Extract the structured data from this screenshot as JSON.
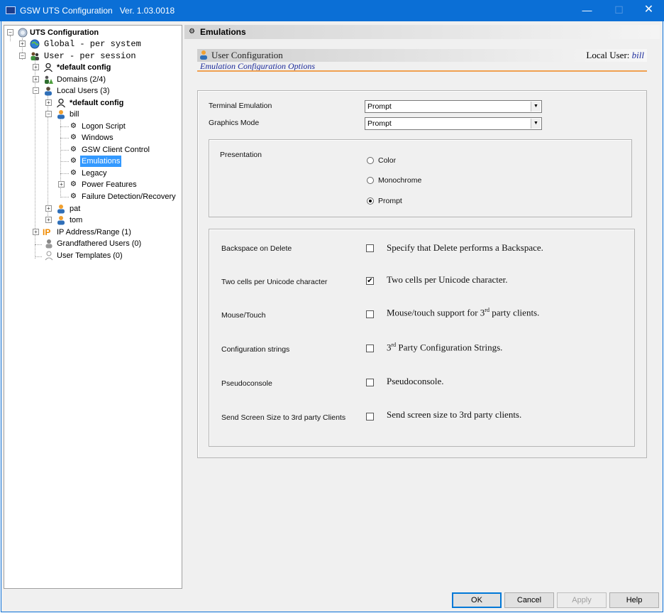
{
  "window": {
    "title": "GSW UTS Configuration",
    "version": "Ver. 1.03.0018",
    "minimize": "—",
    "maximize": "☐",
    "close": "✕"
  },
  "tree": {
    "root": "UTS Configuration",
    "global": "Global - per system",
    "user": "User  - per session",
    "default_config": "*default config",
    "domains": "Domains (2/4)",
    "local_users": "Local Users (3)",
    "lu_default_config": "*default config",
    "bill": "bill",
    "bill_children": [
      "Logon Script",
      "Windows",
      "GSW Client Control",
      "Emulations",
      "Legacy",
      "Power Features",
      "Failure Detection/Recovery"
    ],
    "pat": "pat",
    "tom": "tom",
    "ip_range": "IP Address/Range (1)",
    "grandfathered": "Grandfathered Users (0)",
    "user_templates": "User Templates (0)",
    "ip_icon_text": "IP"
  },
  "header": {
    "title": "Emulations"
  },
  "user_config": {
    "title": "User Configuration",
    "local_user_label": "Local User:",
    "local_user_name": "bill",
    "subtitle": "Emulation Configuration Options"
  },
  "form": {
    "terminal_emulation_label": "Terminal Emulation",
    "terminal_emulation_value": "Prompt",
    "graphics_mode_label": "Graphics Mode",
    "graphics_mode_value": "Prompt",
    "presentation_label": "Presentation",
    "presentation_options": [
      "Color",
      "Monochrome",
      "Prompt"
    ],
    "presentation_selected": "Prompt"
  },
  "options": [
    {
      "label": "Backspace on Delete",
      "checked": false,
      "desc": "Specify that Delete performs a Backspace."
    },
    {
      "label": "Two cells per Unicode character",
      "checked": true,
      "desc": "Two cells per Unicode character."
    },
    {
      "label": "Mouse/Touch",
      "checked": false,
      "desc_pre": "Mouse/touch support for 3",
      "desc_sup": "rd",
      "desc_post": " party clients."
    },
    {
      "label": "Configuration strings",
      "checked": false,
      "desc_pre": "3",
      "desc_sup": "rd",
      "desc_post": " Party Configuration Strings."
    },
    {
      "label": "Pseudoconsole",
      "checked": false,
      "desc": "Pseudoconsole."
    },
    {
      "label": "Send Screen Size to 3rd party Clients",
      "checked": false,
      "desc": "Send screen size to 3rd party clients."
    }
  ],
  "buttons": {
    "ok": "OK",
    "cancel": "Cancel",
    "apply": "Apply",
    "help": "Help"
  },
  "icons": {
    "checkmark": "✔",
    "combo_arrow": "▼",
    "expander_minus": "−",
    "expander_plus": "+"
  }
}
